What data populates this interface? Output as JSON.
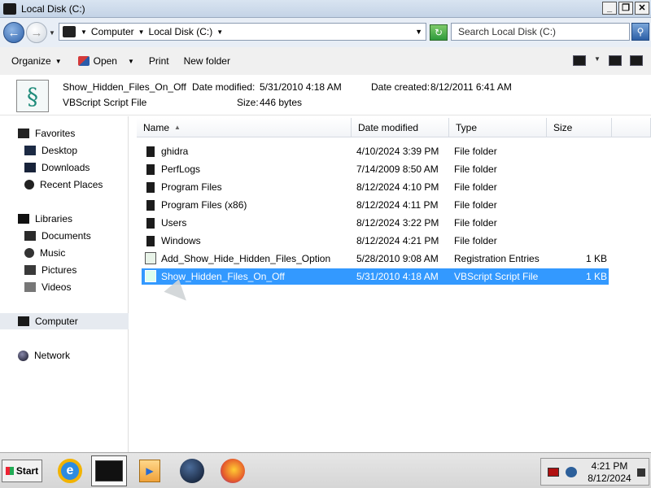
{
  "window": {
    "title": "Local Disk (C:)",
    "buttons": {
      "minimize": "_",
      "restore": "❐",
      "close": "✕"
    }
  },
  "address": {
    "crumbs": [
      "Computer",
      "Local Disk (C:)"
    ],
    "search_placeholder": "Search Local Disk (C:)"
  },
  "toolbar": {
    "organize": "Organize",
    "open": "Open",
    "print": "Print",
    "new_folder": "New folder"
  },
  "details": {
    "name": "Show_Hidden_Files_On_Off",
    "type": "VBScript Script File",
    "modified_label": "Date modified:",
    "modified": "5/31/2010 4:18 AM",
    "created_label": "Date created:",
    "created": "8/12/2011 6:41 AM",
    "size_label": "Size:",
    "size": "446 bytes"
  },
  "sidebar": {
    "favorites": "Favorites",
    "desktop": "Desktop",
    "downloads": "Downloads",
    "recent": "Recent Places",
    "libraries": "Libraries",
    "documents": "Documents",
    "music": "Music",
    "pictures": "Pictures",
    "videos": "Videos",
    "computer": "Computer",
    "network": "Network"
  },
  "columns": {
    "name": "Name",
    "date": "Date modified",
    "type": "Type",
    "size": "Size"
  },
  "files": [
    {
      "name": "ghidra",
      "date": "4/10/2024 3:39 PM",
      "type": "File folder",
      "size": ""
    },
    {
      "name": "PerfLogs",
      "date": "7/14/2009 8:50 AM",
      "type": "File folder",
      "size": ""
    },
    {
      "name": "Program Files",
      "date": "8/12/2024 4:10 PM",
      "type": "File folder",
      "size": ""
    },
    {
      "name": "Program Files (x86)",
      "date": "8/12/2024 4:11 PM",
      "type": "File folder",
      "size": ""
    },
    {
      "name": "Users",
      "date": "8/12/2024 3:22 PM",
      "type": "File folder",
      "size": ""
    },
    {
      "name": "Windows",
      "date": "8/12/2024 4:21 PM",
      "type": "File folder",
      "size": ""
    },
    {
      "name": "Add_Show_Hide_Hidden_Files_Option",
      "date": "5/28/2010 9:08 AM",
      "type": "Registration Entries",
      "size": "1 KB"
    },
    {
      "name": "Show_Hidden_Files_On_Off",
      "date": "5/31/2010 4:18 AM",
      "type": "VBScript Script File",
      "size": "1 KB"
    }
  ],
  "taskbar": {
    "start": "Start",
    "time": "4:21 PM",
    "date": "8/12/2024"
  }
}
